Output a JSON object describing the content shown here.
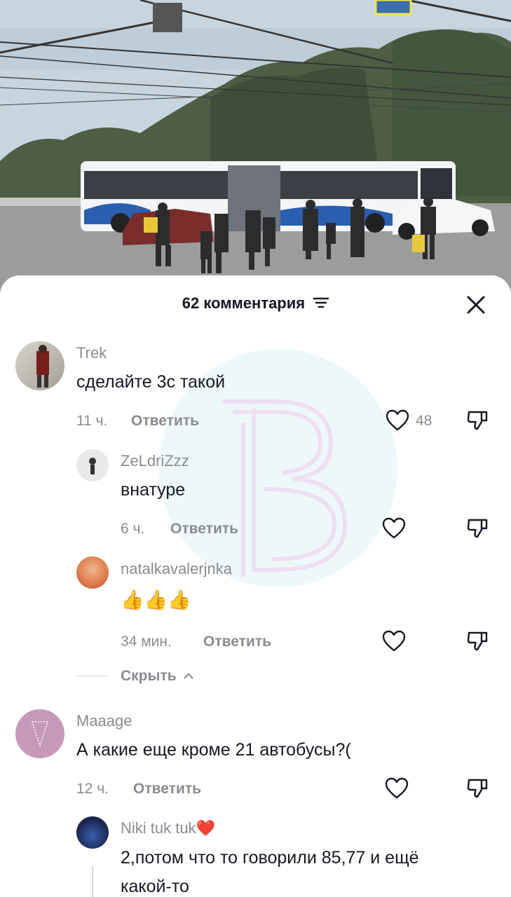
{
  "sheet": {
    "title": "62 комментария",
    "filter_icon": "filter-icon",
    "close_icon": "close-icon"
  },
  "comments": [
    {
      "username": "Trek",
      "text": "сделайте 3с такой",
      "time": "11 ч.",
      "reply": "Ответить",
      "likes": "48",
      "level": "top"
    },
    {
      "username": "ZeLdriZzz",
      "text": "внатуре",
      "time": "6 ч.",
      "reply": "Ответить",
      "likes": "",
      "level": "reply"
    },
    {
      "username": "natalkavalerjnka",
      "text": "👍👍👍",
      "time": "34 мин.",
      "reply": "Ответить",
      "likes": "",
      "level": "reply"
    },
    {
      "username": "Maaage",
      "text": "А какие еще кроме 21 автобусы?(",
      "time": "12 ч.",
      "reply": "Ответить",
      "likes": "",
      "level": "top"
    },
    {
      "username": "Niki tuk tuk❤️",
      "text_line1": "2,потом что то говорили 85,77 и ещё",
      "text_line2": "какой-то",
      "level": "reply"
    }
  ],
  "hide_replies": "Скрыть",
  "colors": {
    "muted": "#8a8b91",
    "text": "#161823",
    "watermark": "#bfe6f2"
  }
}
